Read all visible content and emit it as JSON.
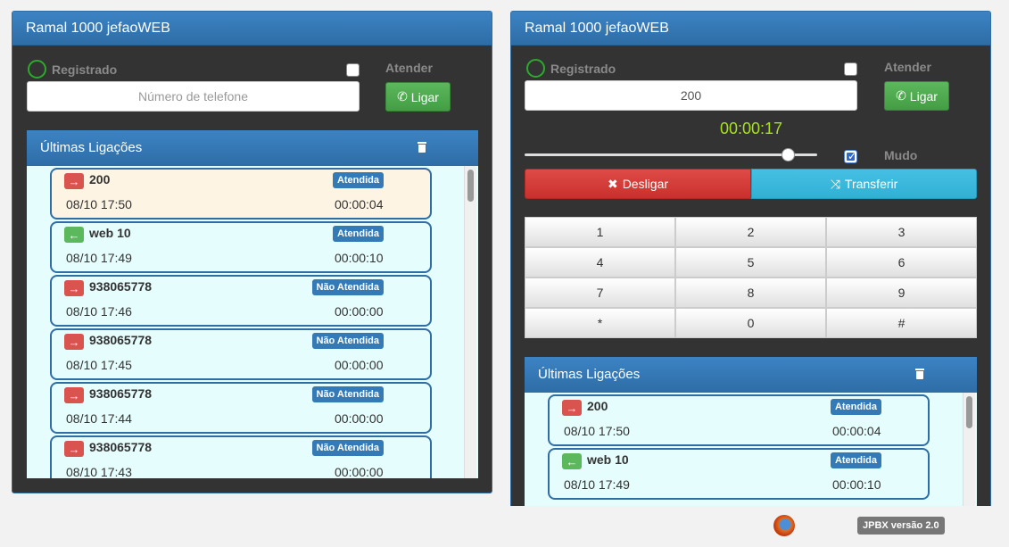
{
  "left": {
    "title": "Ramal 1000 jefaoWEB",
    "status": "Registrado",
    "atender_label": "Atender",
    "phone_placeholder": "Número de telefone",
    "ligar_label": "Ligar",
    "history_title": "Últimas Ligações",
    "calls": [
      {
        "number": "200",
        "dir": "out",
        "status": "Atendida",
        "date": "08/10 17:50",
        "duration": "00:00:04"
      },
      {
        "number": "web 10",
        "dir": "in",
        "status": "Atendida",
        "date": "08/10 17:49",
        "duration": "00:00:10"
      },
      {
        "number": "938065778",
        "dir": "out",
        "status": "Não Atendida",
        "date": "08/10 17:46",
        "duration": "00:00:00"
      },
      {
        "number": "938065778",
        "dir": "out",
        "status": "Não Atendida",
        "date": "08/10 17:45",
        "duration": "00:00:00"
      },
      {
        "number": "938065778",
        "dir": "out",
        "status": "Não Atendida",
        "date": "08/10 17:44",
        "duration": "00:00:00"
      },
      {
        "number": "938065778",
        "dir": "out",
        "status": "Não Atendida",
        "date": "08/10 17:43",
        "duration": "00:00:00"
      }
    ]
  },
  "right": {
    "title": "Ramal 1000 jefaoWEB",
    "status": "Registrado",
    "atender_label": "Atender",
    "phone_value": "200",
    "ligar_label": "Ligar",
    "timer": "00:00:17",
    "volume": 0.9,
    "mudo_label": "Mudo",
    "desligar_label": "Desligar",
    "transferir_label": "Transferir",
    "keys": [
      "1",
      "2",
      "3",
      "4",
      "5",
      "6",
      "7",
      "8",
      "9",
      "*",
      "0",
      "#"
    ],
    "history_title": "Últimas Ligações",
    "calls": [
      {
        "number": "200",
        "dir": "out",
        "status": "Atendida",
        "date": "08/10 17:50",
        "duration": "00:00:04"
      },
      {
        "number": "web 10",
        "dir": "in",
        "status": "Atendida",
        "date": "08/10 17:49",
        "duration": "00:00:10"
      }
    ]
  },
  "version": "JPBX versão 2.0",
  "colors": {
    "primary": "#337ab7",
    "success": "#5cb85c",
    "danger": "#d9534f",
    "info": "#31b0d5",
    "timer": "#a8e21b"
  }
}
